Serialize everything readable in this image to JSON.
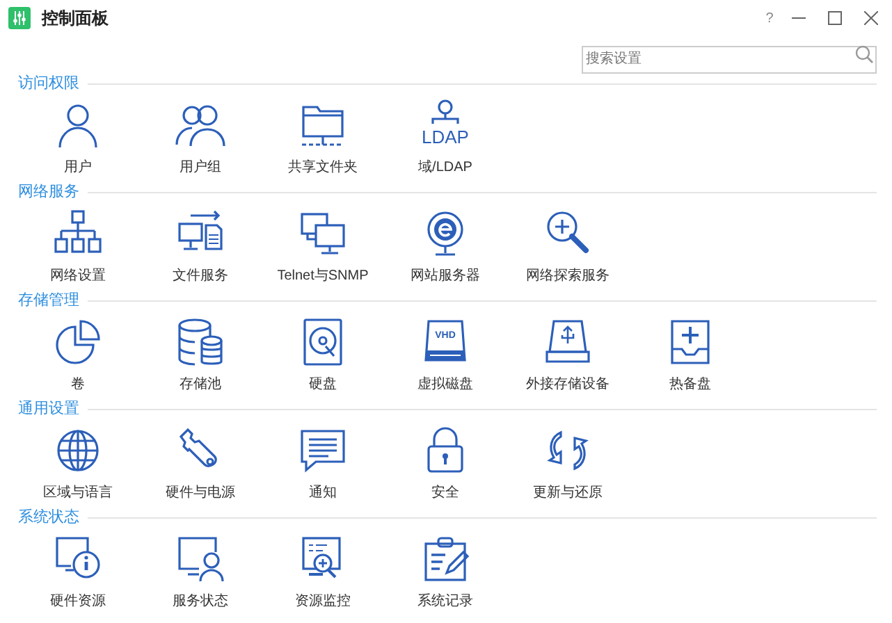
{
  "window": {
    "title": "控制面板",
    "help": "?"
  },
  "search": {
    "placeholder": "搜索设置"
  },
  "sections": [
    {
      "title": "访问权限",
      "items": [
        {
          "label": "用户"
        },
        {
          "label": "用户组"
        },
        {
          "label": "共享文件夹"
        },
        {
          "label": "域/LDAP",
          "icon_text": "LDAP"
        }
      ]
    },
    {
      "title": "网络服务",
      "items": [
        {
          "label": "网络设置"
        },
        {
          "label": "文件服务"
        },
        {
          "label": "Telnet与SNMP"
        },
        {
          "label": "网站服务器"
        },
        {
          "label": "网络探索服务"
        }
      ]
    },
    {
      "title": "存储管理",
      "items": [
        {
          "label": "卷"
        },
        {
          "label": "存储池"
        },
        {
          "label": "硬盘"
        },
        {
          "label": "虚拟磁盘",
          "icon_text": "VHD"
        },
        {
          "label": "外接存储设备"
        },
        {
          "label": "热备盘"
        }
      ]
    },
    {
      "title": "通用设置",
      "items": [
        {
          "label": "区域与语言"
        },
        {
          "label": "硬件与电源"
        },
        {
          "label": "通知"
        },
        {
          "label": "安全"
        },
        {
          "label": "更新与还原"
        }
      ]
    },
    {
      "title": "系统状态",
      "items": [
        {
          "label": "硬件资源"
        },
        {
          "label": "服务状态"
        },
        {
          "label": "资源监控"
        },
        {
          "label": "系统记录"
        }
      ]
    }
  ]
}
